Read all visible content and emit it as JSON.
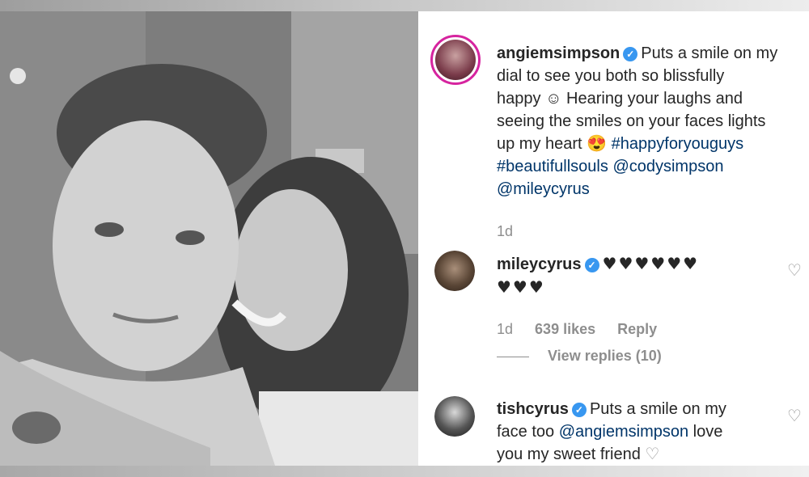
{
  "post": {
    "caption": {
      "username": "angiemsimpson",
      "line1_text": "Puts a smile on my",
      "line2": "dial to see you both so blissfully",
      "line3_text": "happy",
      "emoji_smile": "☺",
      "line3_rest": "Hearing your laughs and",
      "line4": "seeing the smiles on your faces lights",
      "line5_text": "up my heart",
      "emoji_heart_eyes": "😍",
      "hashtag1": "#happyforyouguys",
      "hashtag2": "#beautifullsouls",
      "mention1": "@codysimpson",
      "mention2": "@mileycyrus",
      "time": "1d"
    },
    "comments": [
      {
        "username": "mileycyrus",
        "text_line1": "♥♥♥♥♥♥",
        "text_line2": "♥♥♥",
        "time": "1d",
        "likes": "639 likes",
        "reply": "Reply",
        "view_replies": "View replies (10)"
      },
      {
        "username": "tishcyrus",
        "text_line1": "Puts a smile on my",
        "text_line2_prefix": "face too",
        "mention": "@angiemsimpson",
        "text_line2_suffix": "love",
        "text_line3": "you my sweet friend",
        "emoji": "♡"
      }
    ],
    "icons": {
      "verified": "✓",
      "like": "♡"
    }
  },
  "colors": {
    "verified": "#3897f0",
    "link": "#003569",
    "meta": "#8e8e8e",
    "story_ring": "#d6249f"
  }
}
